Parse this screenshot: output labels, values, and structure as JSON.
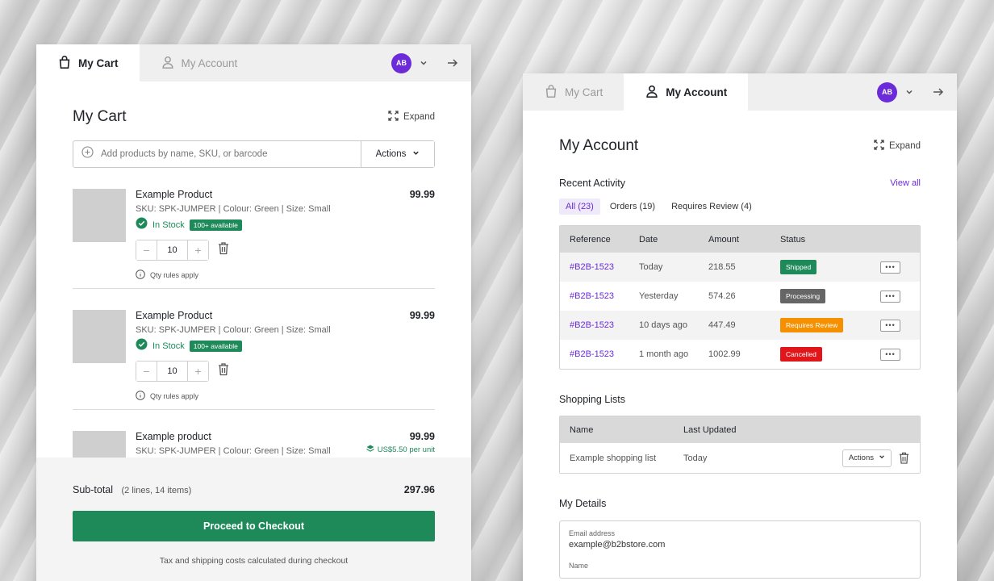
{
  "cart": {
    "tabs": {
      "cart": "My Cart",
      "account": "My Account"
    },
    "avatar": "AB",
    "title": "My Cart",
    "expand_label": "Expand",
    "search_placeholder": "Add products by name, SKU, or barcode",
    "actions_label": "Actions",
    "items": [
      {
        "name": "Example Product",
        "price": "99.99",
        "sku": "SKU: SPK-JUMPER | Colour: Green | Size: Small",
        "stock": "In Stock",
        "available": "100+ available",
        "qty": "10",
        "qty_note": "Qty rules apply",
        "unit_price": ""
      },
      {
        "name": "Example Product",
        "price": "99.99",
        "sku": "SKU: SPK-JUMPER | Colour: Green | Size: Small",
        "stock": "In Stock",
        "available": "100+ available",
        "qty": "10",
        "qty_note": "Qty rules apply",
        "unit_price": ""
      },
      {
        "name": "Example product",
        "price": "99.99",
        "sku": "SKU: SPK-JUMPER | Colour: Green | Size: Small",
        "stock": "",
        "available": "",
        "qty": "",
        "qty_note": "",
        "unit_price": "US$5.50 per unit"
      }
    ],
    "subtotal_label": "Sub-total",
    "subtotal_meta": "(2 lines, 14 items)",
    "subtotal_value": "297.96",
    "checkout_label": "Proceed to Checkout",
    "tax_note": "Tax and shipping costs calculated during checkout"
  },
  "account": {
    "tabs": {
      "cart": "My Cart",
      "account": "My Account"
    },
    "avatar": "AB",
    "title": "My Account",
    "expand_label": "Expand",
    "recent_activity": {
      "title": "Recent Activity",
      "view_all": "View all",
      "filters": [
        "All (23)",
        "Orders (19)",
        "Requires Review (4)"
      ],
      "columns": [
        "Reference",
        "Date",
        "Amount",
        "Status"
      ],
      "rows": [
        {
          "ref": "#B2B-1523",
          "date": "Today",
          "amount": "218.55",
          "status": "Shipped",
          "status_color": "#1e8a5a"
        },
        {
          "ref": "#B2B-1523",
          "date": "Yesterday",
          "amount": "574.26",
          "status": "Processing",
          "status_color": "#666666"
        },
        {
          "ref": "#B2B-1523",
          "date": "10 days ago",
          "amount": "447.49",
          "status": "Requires Review",
          "status_color": "#f59000"
        },
        {
          "ref": "#B2B-1523",
          "date": "1 month ago",
          "amount": "1002.99",
          "status": "Cancelled",
          "status_color": "#e0161b"
        }
      ]
    },
    "shopping_lists": {
      "title": "Shopping Lists",
      "columns": [
        "Name",
        "Last Updated"
      ],
      "rows": [
        {
          "name": "Example shopping list",
          "updated": "Today",
          "actions": "Actions"
        }
      ]
    },
    "details": {
      "title": "My Details",
      "email_label": "Email address",
      "email_value": "example@b2bstore.com",
      "name_label": "Name"
    }
  },
  "colors": {
    "accent_purple": "#6b2bd9",
    "green": "#1e8a5a"
  }
}
